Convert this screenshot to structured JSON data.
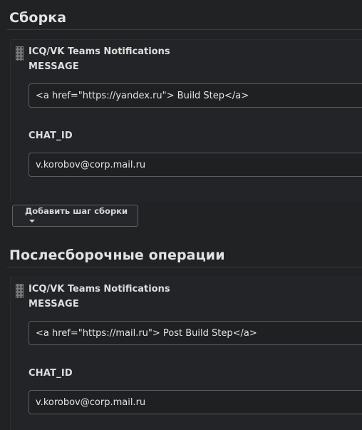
{
  "build": {
    "title": "Сборка",
    "step": {
      "name": "ICQ/VK Teams Notifications",
      "message_label": "MESSAGE",
      "message_value": "<a href=\"https://yandex.ru\"> Build Step</a>",
      "chat_id_label": "CHAT_ID",
      "chat_id_value": "v.korobov@corp.mail.ru"
    },
    "add_step_label": "Добавить шаг сборки"
  },
  "post_build": {
    "title": "Послесборочные операции",
    "step": {
      "name": "ICQ/VK Teams Notifications",
      "message_label": "MESSAGE",
      "message_value": "<a href=\"https://mail.ru\"> Post Build Step</a>",
      "chat_id_label": "CHAT_ID",
      "chat_id_value": "v.korobov@corp.mail.ru"
    }
  },
  "icons": {
    "drag_handle": "drag-handle-icon",
    "dropdown": "caret-down-icon"
  },
  "colors": {
    "background": "#212224",
    "input_border": "#5b5c60",
    "text": "#dcdcdc"
  }
}
